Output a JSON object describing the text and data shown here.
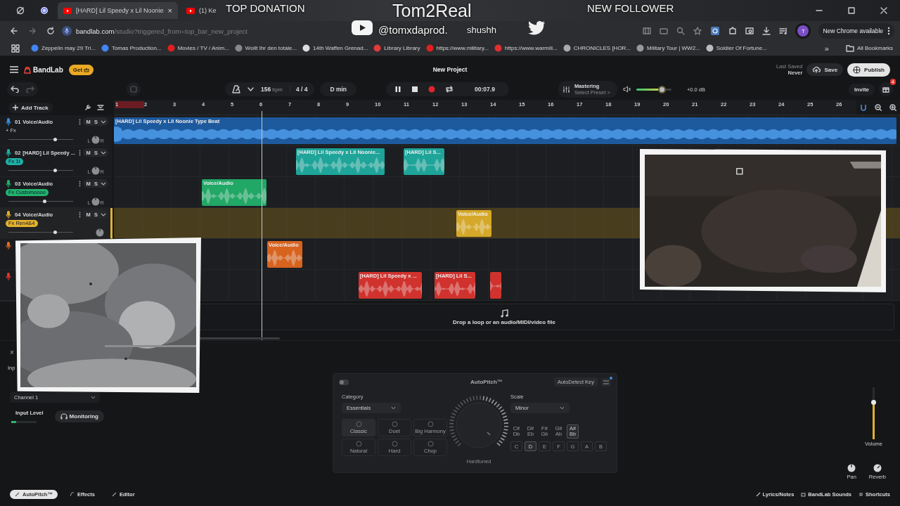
{
  "stream_overlay": {
    "top_donation": "TOP DONATION",
    "channel": "Tom2Real",
    "youtube_handle": "@tomxdaprod.",
    "twitter_handle": "shushh",
    "new_follower": "NEW FOLLOWER"
  },
  "browser": {
    "tabs": [
      {
        "kind": "pinned",
        "selected": false
      },
      {
        "kind": "pinned",
        "selected": false
      },
      {
        "kind": "page",
        "title": "[HARD] Lil Speedy x Lil Noonie",
        "close": "×",
        "selected": true
      },
      {
        "kind": "page",
        "title": "(1) Ke",
        "selected": false
      }
    ],
    "url_domain": "bandlab.com",
    "url_path": "/studio?triggered_from=top_bar_new_project",
    "profile": "T",
    "update_label": "New Chrome available",
    "bookmarks": [
      {
        "title": "Zeppelin may 29 Tri..."
      },
      {
        "title": "Tomas Production..."
      },
      {
        "title": "Movies / TV / Anim..."
      },
      {
        "title": "Wollt Ihr den totale..."
      },
      {
        "title": "14th Waffen Grenad..."
      },
      {
        "title": "Library Library"
      },
      {
        "title": "https://www.military..."
      },
      {
        "title": "https://www.warmili..."
      },
      {
        "title": "CHRONICLES [HOR..."
      },
      {
        "title": "Military Tour | WW2..."
      },
      {
        "title": "Soldier Of Fortune..."
      }
    ],
    "more_bookmarks": "»",
    "all_bookmarks": "All Bookmarks"
  },
  "header": {
    "logo": "BandLab",
    "get": "Get",
    "title": "New Project",
    "last_saved_label": "Last Saved",
    "last_saved_value": "Never",
    "save": "Save",
    "publish": "Publish",
    "invite": "Invite",
    "notification_count": "4"
  },
  "toolbar": {
    "bpm": "156",
    "bpm_unit": "bpm",
    "time_signature": "4 / 4",
    "key": "D min",
    "playing": true,
    "time": "00:07.9",
    "mastering": "Mastering",
    "mastering_preset": "Select Preset >",
    "master_volume": {
      "level": 0.72
    },
    "master_db": "+0.0 dB"
  },
  "add_track": "Add Track",
  "ruler": [
    "1",
    "2",
    "3",
    "4",
    "5",
    "6",
    "7",
    "8",
    "9",
    "10",
    "11",
    "12",
    "13",
    "14",
    "15",
    "16",
    "17",
    "18",
    "19",
    "20",
    "21",
    "22",
    "23",
    "24",
    "25",
    "26"
  ],
  "tracks": [
    {
      "number": "01",
      "name": "Voice/Audio",
      "mute": "M",
      "solo": "S",
      "fx": {
        "kind": "add",
        "label": "+ Fx"
      },
      "color": "#3b8fdb",
      "selected": false,
      "volume": {
        "level": 0.72
      },
      "pan": {
        "left": "L",
        "right": "R"
      },
      "clips": [
        {
          "kind": "audio",
          "label": "[HARD] Lil Speedy x Lil Noonie Type Beat"
        }
      ]
    },
    {
      "number": "02",
      "name": "[HARD] Lil Speedy ...",
      "mute": "M",
      "solo": "S",
      "fx": {
        "kind": "preset",
        "label": "Fx 1t"
      },
      "color": "#1fb0a4",
      "selected": false,
      "volume": {
        "level": 0.72
      },
      "pan": {
        "left": "L",
        "right": "R"
      },
      "clips": [
        {
          "kind": "audio",
          "label": "[HARD] Lil Speedy x Lil Noonie..."
        },
        {
          "kind": "audio",
          "label": "[HARD] Lil S..."
        }
      ]
    },
    {
      "number": "03",
      "name": "Voice/Audio",
      "mute": "M",
      "solo": "S",
      "fx": {
        "kind": "preset",
        "label": "Fx Customoooo"
      },
      "color": "#22b36c",
      "selected": false,
      "volume": {
        "level": 0.55
      },
      "pan": {
        "left": "L",
        "right": "R"
      },
      "clips": [
        {
          "kind": "audio",
          "label": "Voice/Audio"
        }
      ]
    },
    {
      "number": "04",
      "name": "Voice/Audio",
      "mute": "M",
      "solo": "S",
      "fx": {
        "kind": "preset",
        "label": "Fx Ren4&4"
      },
      "color": "#e2b22b",
      "selected": true,
      "volume": {
        "level": 0.72
      },
      "clips": [
        {
          "kind": "audio",
          "label": "Voice/Audio"
        }
      ]
    },
    {
      "color": "#e8691f",
      "selected": false,
      "clips": [
        {
          "kind": "audio",
          "label": "Voice/Audio"
        }
      ]
    },
    {
      "color": "#e0342f",
      "selected": false,
      "clips": [
        {
          "kind": "audio",
          "label": "[HARD] Lil Speedy x ..."
        },
        {
          "kind": "audio",
          "label": "[HARD] Lil S..."
        },
        {
          "kind": "audio"
        }
      ]
    }
  ],
  "drop_zone": "Drop a loop or an audio/MIDI/video file",
  "input_panel": {
    "close": "×",
    "heading": "Inp",
    "channel": "Channel 1",
    "input_level_label": "Input Level",
    "input_level": {
      "level": 0.2
    },
    "monitoring": "Monitoring"
  },
  "autopitch": {
    "enabled": false,
    "title": "AutoPitch™",
    "autodetect": "AutoDetect Key",
    "category_label": "Category",
    "category": "Essentials",
    "effects": [
      {
        "label": "Classic",
        "selected": true
      },
      {
        "label": "Duet",
        "selected": false
      },
      {
        "label": "Big Harmony",
        "selected": false
      },
      {
        "label": "Natural",
        "selected": false
      },
      {
        "label": "Hard",
        "selected": false
      },
      {
        "label": "Chop",
        "selected": false
      }
    ],
    "knob_label": "Hardtuned",
    "scale_label": "Scale",
    "scale": "Minor",
    "sharps": [
      {
        "label": "C# Db",
        "selected": false
      },
      {
        "label": "D# Eb",
        "selected": false
      },
      {
        "label": "F# Gb",
        "selected": false
      },
      {
        "label": "G# Ab",
        "selected": false
      },
      {
        "label": "A# Bb",
        "selected": true
      }
    ],
    "naturals": [
      {
        "label": "C",
        "selected": false
      },
      {
        "label": "D",
        "selected": true
      },
      {
        "label": "E",
        "selected": false
      },
      {
        "label": "F",
        "selected": false
      },
      {
        "label": "G",
        "selected": false
      },
      {
        "label": "A",
        "selected": false
      },
      {
        "label": "B",
        "selected": false
      }
    ]
  },
  "mixer": {
    "volume": {
      "level": 0.7
    },
    "volume_label": "Volume",
    "pan_label": "Pan",
    "reverb_label": "Reverb"
  },
  "footer": {
    "tabs": [
      {
        "label": "AutoPitch™",
        "selected": true
      },
      {
        "label": "Effects",
        "selected": false
      },
      {
        "label": "Editor",
        "selected": false
      }
    ],
    "links": [
      {
        "label": "Lyrics/Notes"
      },
      {
        "label": "BandLab Sounds"
      },
      {
        "label": "Shortcuts"
      }
    ]
  }
}
